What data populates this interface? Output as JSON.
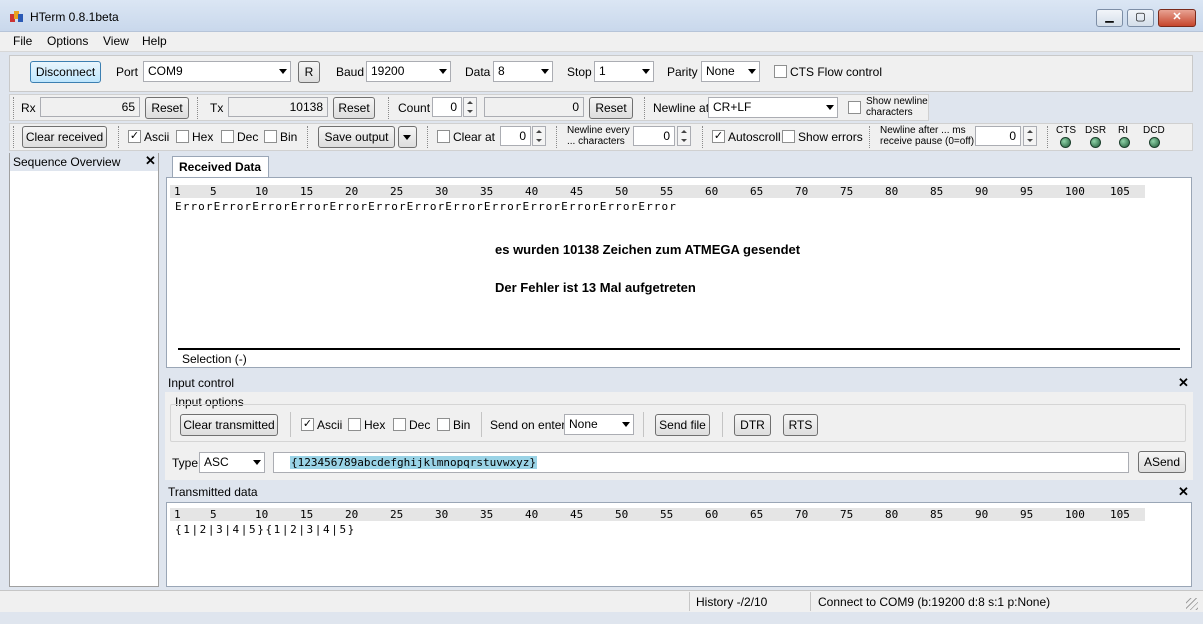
{
  "window": {
    "title": "HTerm 0.8.1beta",
    "min": "▁",
    "max": "▢",
    "close": "✕"
  },
  "menu": [
    "File",
    "Options",
    "View",
    "Help"
  ],
  "connection": {
    "disconnect_label": "Disconnect",
    "port_label": "Port",
    "port_value": "COM9",
    "refresh_label": "R",
    "baud_label": "Baud",
    "baud_value": "19200",
    "data_label": "Data",
    "data_value": "8",
    "stop_label": "Stop",
    "stop_value": "1",
    "parity_label": "Parity",
    "parity_value": "None",
    "cts_label": "CTS Flow control"
  },
  "counters": {
    "rx_label": "Rx",
    "rx_value": "65",
    "rx_reset": "Reset",
    "tx_label": "Tx",
    "tx_value": "10138",
    "tx_reset": "Reset",
    "count_label": "Count",
    "count_value": "0",
    "count_field": "0",
    "count_reset": "Reset",
    "newline_label": "Newline at",
    "newline_value": "CR+LF",
    "show_newline_label": "Show newline characters"
  },
  "receive_options": {
    "clear_received": "Clear received",
    "ascii": "Ascii",
    "hex": "Hex",
    "dec": "Dec",
    "bin": "Bin",
    "save_output": "Save output",
    "clear_at": "Clear at",
    "clear_at_value": "0",
    "newline_every": "Newline every ... characters",
    "newline_every_value": "0",
    "autoscroll": "Autoscroll",
    "show_errors": "Show errors",
    "newline_after": "Newline after ... ms receive pause (0=off)",
    "newline_after_value": "0",
    "status_leds": [
      "CTS",
      "DSR",
      "RI",
      "DCD"
    ]
  },
  "sequence_overview": {
    "title": "Sequence Overview"
  },
  "received": {
    "tab_label": "Received Data",
    "ruler": [
      "1",
      "5",
      "10",
      "15",
      "20",
      "25",
      "30",
      "35",
      "40",
      "45",
      "50",
      "55",
      "60",
      "65",
      "70",
      "75",
      "80",
      "85",
      "90",
      "95",
      "100",
      "105"
    ],
    "content": "ErrorErrorErrorErrorErrorErrorErrorErrorErrorErrorErrorErrorError",
    "annotation_1": "es wurden 10138 Zeichen zum ATMEGA gesendet",
    "annotation_2": "Der Fehler ist 13 Mal aufgetreten",
    "selection": "Selection (-)"
  },
  "input_control": {
    "title": "Input control",
    "options_title": "Input options",
    "clear_transmitted": "Clear transmitted",
    "ascii": "Ascii",
    "hex": "Hex",
    "dec": "Dec",
    "bin": "Bin",
    "send_on_enter_label": "Send on enter",
    "send_on_enter_value": "None",
    "send_file": "Send file",
    "dtr": "DTR",
    "rts": "RTS",
    "type_label": "Type",
    "type_value": "ASC",
    "input_value": "{123456789abcdefghijklmnopqrstuvwxyz}",
    "asend": "ASend"
  },
  "transmitted": {
    "title": "Transmitted data",
    "ruler": [
      "1",
      "5",
      "10",
      "15",
      "20",
      "25",
      "30",
      "35",
      "40",
      "45",
      "50",
      "55",
      "60",
      "65",
      "70",
      "75",
      "80",
      "85",
      "90",
      "95",
      "100",
      "105"
    ],
    "content": "{1|2|3|4|5}{1|2|3|4|5}"
  },
  "status": {
    "history": "History -/2/10",
    "connection": "Connect to COM9 (b:19200 d:8 s:1 p:None)"
  },
  "colors": {
    "selection_highlight": "#9ad3e6",
    "led": "#1e5a37"
  }
}
